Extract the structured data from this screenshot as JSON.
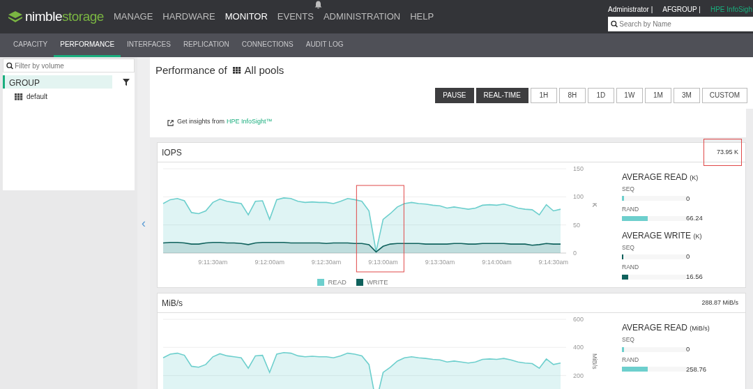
{
  "header": {
    "logo": {
      "part_a": "nimble",
      "part_b": "storage"
    },
    "nav": [
      {
        "label": "MANAGE",
        "selected": false,
        "bell": false
      },
      {
        "label": "HARDWARE",
        "selected": false,
        "bell": false
      },
      {
        "label": "MONITOR",
        "selected": true,
        "bell": false
      },
      {
        "label": "EVENTS",
        "selected": false,
        "bell": true
      },
      {
        "label": "ADMINISTRATION",
        "selected": false,
        "bell": false
      },
      {
        "label": "HELP",
        "selected": false,
        "bell": false
      }
    ],
    "user_links": [
      {
        "label": "Administrator |",
        "kind": "text"
      },
      {
        "label": "AFGROUP |",
        "kind": "text"
      },
      {
        "label": "HPE InfoSigh",
        "kind": "link"
      }
    ],
    "search": {
      "placeholder": "Search by Name"
    }
  },
  "tabs": [
    {
      "label": "CAPACITY",
      "selected": false
    },
    {
      "label": "PERFORMANCE",
      "selected": true
    },
    {
      "label": "INTERFACES",
      "selected": false
    },
    {
      "label": "REPLICATION",
      "selected": false
    },
    {
      "label": "CONNECTIONS",
      "selected": false
    },
    {
      "label": "AUDIT LOG",
      "selected": false
    }
  ],
  "sidebar": {
    "filter": {
      "placeholder": "Filter by volume"
    },
    "group": {
      "label": "GROUP",
      "selected": true
    },
    "items": [
      {
        "label": "default"
      }
    ],
    "collapse": "‹"
  },
  "title": {
    "text": "Performance of",
    "target": "All pools"
  },
  "time_buttons": [
    {
      "label": "PAUSE",
      "selected": true
    },
    {
      "label": "REAL-TIME",
      "selected": true
    },
    {
      "label": "1H",
      "selected": false
    },
    {
      "label": "8H",
      "selected": false
    },
    {
      "label": "1D",
      "selected": false
    },
    {
      "label": "1W",
      "selected": false
    },
    {
      "label": "1M",
      "selected": false
    },
    {
      "label": "3M",
      "selected": false
    },
    {
      "label": "CUSTOM",
      "selected": false
    }
  ],
  "insights": {
    "text": "Get insights from",
    "link": "HPE InfoSight™"
  },
  "panels": [
    {
      "title": "IOPS",
      "total": "73.95 K",
      "highlighted": true,
      "dip_highlighted": true,
      "chart_data": {
        "type": "area",
        "ylabel": "K",
        "ylim": [
          0,
          150
        ],
        "yticks": [
          150,
          100,
          50,
          0
        ],
        "categories": [
          null,
          null,
          null,
          null,
          null,
          null,
          null,
          "9:11:30am",
          null,
          null,
          null,
          null,
          null,
          null,
          null,
          "9:12:00am",
          null,
          null,
          null,
          null,
          null,
          null,
          null,
          "9:12:30am",
          null,
          null,
          null,
          null,
          null,
          null,
          null,
          "9:13:00am",
          null,
          null,
          null,
          null,
          null,
          null,
          null,
          "9:13:30am",
          null,
          null,
          null,
          null,
          null,
          null,
          null,
          "9:14:00am",
          null,
          null,
          null,
          null,
          null,
          null,
          null,
          "9:14:30am",
          null
        ],
        "series": [
          {
            "name": "READ",
            "color": "#6dcfcd",
            "values": [
              88,
              95,
              97,
              93,
              72,
              70,
              75,
              90,
              96,
              92,
              90,
              88,
              68,
              92,
              93,
              60,
              95,
              98,
              97,
              92,
              90,
              91,
              90,
              90,
              88,
              92,
              97,
              95,
              92,
              75,
              3,
              60,
              70,
              82,
              88,
              90,
              88,
              87,
              85,
              84,
              80,
              82,
              80,
              78,
              80,
              85,
              86,
              85,
              87,
              84,
              80,
              78,
              77,
              68,
              86,
              75,
              78
            ]
          },
          {
            "name": "WRITE",
            "color": "#0f615c",
            "values": [
              18,
              19,
              19,
              18,
              16,
              16,
              18,
              19,
              19,
              18,
              18,
              17,
              15,
              18,
              19,
              19,
              19,
              19,
              18,
              18,
              18,
              18,
              18,
              17,
              18,
              18,
              18,
              17,
              17,
              15,
              2,
              12,
              16,
              17,
              17,
              17,
              17,
              16,
              16,
              16,
              16,
              17,
              17,
              16,
              16,
              17,
              17,
              17,
              17,
              16,
              16,
              16,
              14,
              15,
              17,
              16,
              16
            ]
          }
        ]
      },
      "stats": [
        {
          "title": "AVERAGE READ",
          "unit": "(K)",
          "color": "#6dcfcd",
          "rows": [
            {
              "label": "SEQ",
              "value": "0",
              "level": 0.03
            },
            {
              "label": "RAND",
              "value": "66.24",
              "level": 0.4
            }
          ]
        },
        {
          "title": "AVERAGE WRITE",
          "unit": "(K)",
          "color": "#0f615c",
          "rows": [
            {
              "label": "SEQ",
              "value": "0",
              "level": 0.02
            },
            {
              "label": "RAND",
              "value": "16.56",
              "level": 0.1
            }
          ]
        }
      ]
    },
    {
      "title": "MiB/s",
      "total": "288.87 MiB/s",
      "highlighted": false,
      "chart_data": {
        "type": "area",
        "ylabel": "MiB/s",
        "ylim": [
          0,
          600
        ],
        "yticks": [
          600,
          400,
          200
        ],
        "categories": [
          null,
          null,
          null,
          null,
          null,
          null,
          null,
          null,
          null,
          null,
          null,
          null,
          null,
          null,
          null,
          null,
          null,
          null,
          null,
          null,
          null,
          null,
          null,
          null,
          null,
          null,
          null,
          null,
          null,
          null,
          null,
          null,
          null,
          null,
          null,
          null,
          null,
          null,
          null,
          null,
          null,
          null,
          null,
          null,
          null,
          null,
          null,
          null,
          null,
          null,
          null,
          null,
          null,
          null,
          null,
          null,
          null
        ],
        "series": [
          {
            "color": "#6dcfcd",
            "values": [
              326,
              352,
              359,
              344,
              266,
              259,
              278,
              333,
              355,
              340,
              333,
              326,
              252,
              340,
              344,
              222,
              352,
              363,
              359,
              340,
              333,
              337,
              333,
              333,
              326,
              340,
              359,
              352,
              340,
              278,
              11,
              222,
              259,
              303,
              326,
              333,
              326,
              322,
              315,
              311,
              296,
              303,
              296,
              289,
              296,
              315,
              318,
              315,
              322,
              311,
              296,
              289,
              285,
              252,
              318,
              278,
              289
            ]
          }
        ]
      },
      "stats": [
        {
          "title": "AVERAGE READ",
          "unit": "(MiB/s)",
          "color": "#6dcfcd",
          "rows": [
            {
              "label": "SEQ",
              "value": "0",
              "level": 0.03
            },
            {
              "label": "RAND",
              "value": "258.76",
              "level": 0.4
            }
          ]
        }
      ]
    }
  ]
}
